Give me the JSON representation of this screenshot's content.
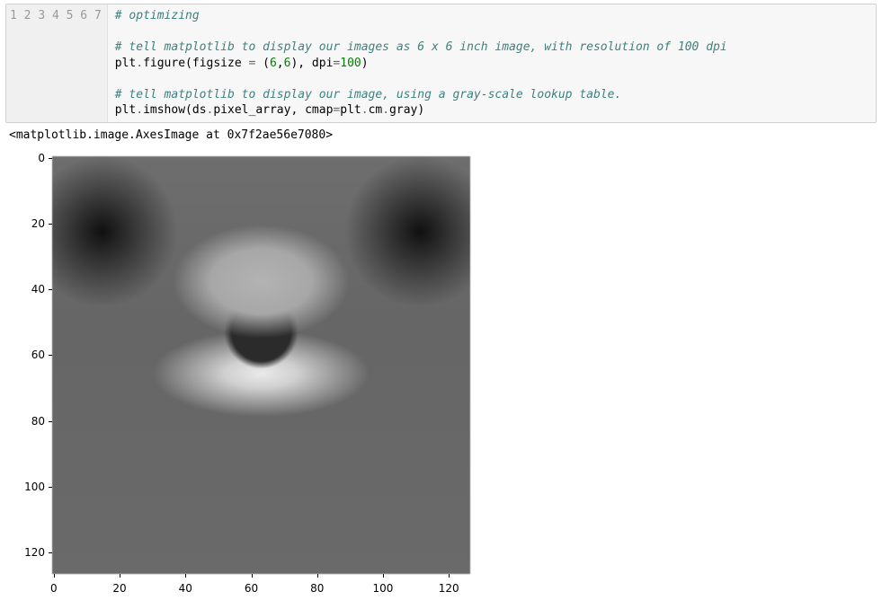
{
  "code": {
    "line_numbers": [
      "1",
      "2",
      "3",
      "4",
      "5",
      "6",
      "7"
    ],
    "l1": "# optimizing",
    "l2": "",
    "l3": "# tell matplotlib to display our images as 6 x 6 inch image, with resolution of 100 dpi",
    "l4a": "plt",
    "l4b": ".",
    "l4c": "figure(figsize ",
    "l4d": "=",
    "l4e": " (",
    "l4f": "6",
    "l4g": ",",
    "l4h": "6",
    "l4i": "), dpi",
    "l4j": "=",
    "l4k": "100",
    "l4l": ")",
    "l5": "",
    "l6": "# tell matplotlib to display our image, using a gray-scale lookup table.",
    "l7a": "plt",
    "l7b": ".",
    "l7c": "imshow(ds",
    "l7d": ".",
    "l7e": "pixel_array, cmap",
    "l7f": "=",
    "l7g": "plt",
    "l7h": ".",
    "l7i": "cm",
    "l7j": ".",
    "l7k": "gray)"
  },
  "output_text": "<matplotlib.image.AxesImage at 0x7f2ae56e7080>",
  "chart_data": {
    "type": "heatmap",
    "title": "",
    "xlabel": "",
    "ylabel": "",
    "xlim": [
      -0.5,
      127.5
    ],
    "ylim": [
      127.5,
      -0.5
    ],
    "x_ticks": [
      0,
      20,
      40,
      60,
      80,
      100,
      120
    ],
    "y_ticks": [
      0,
      20,
      40,
      60,
      80,
      100,
      120
    ],
    "cmap": "gray",
    "description": "Grayscale CT image (ds.pixel_array) rendered with imshow; vertebral body and surrounding tissue visible."
  },
  "ticks": {
    "y": [
      {
        "label": "0",
        "pct": 0.39
      },
      {
        "label": "20",
        "pct": 16.14
      },
      {
        "label": "40",
        "pct": 31.89
      },
      {
        "label": "60",
        "pct": 47.64
      },
      {
        "label": "80",
        "pct": 63.39
      },
      {
        "label": "100",
        "pct": 79.13
      },
      {
        "label": "120",
        "pct": 94.88
      }
    ],
    "x": [
      {
        "label": "0",
        "pct": 0.39
      },
      {
        "label": "20",
        "pct": 16.14
      },
      {
        "label": "40",
        "pct": 31.89
      },
      {
        "label": "60",
        "pct": 47.64
      },
      {
        "label": "80",
        "pct": 63.39
      },
      {
        "label": "100",
        "pct": 79.13
      },
      {
        "label": "120",
        "pct": 94.88
      }
    ]
  }
}
